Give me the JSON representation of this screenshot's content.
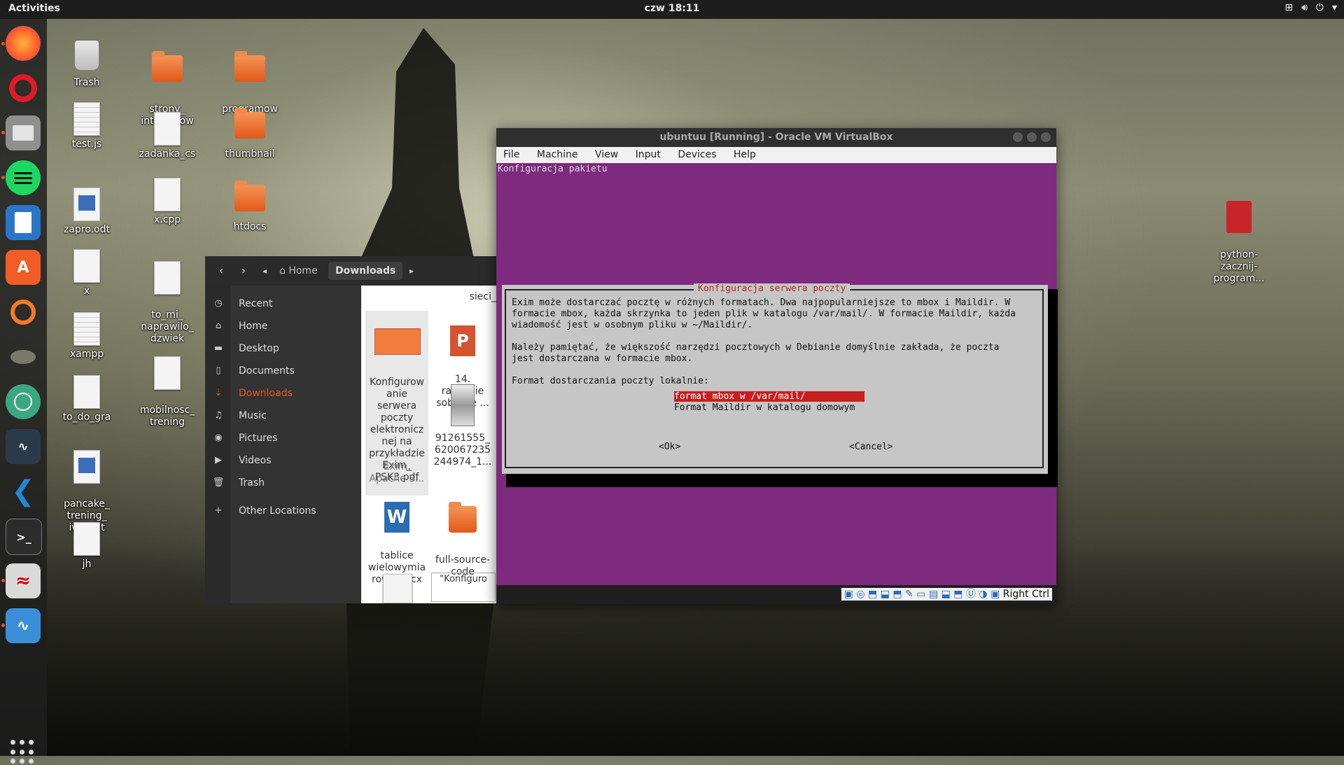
{
  "topbar": {
    "activities": "Activities",
    "clock": "czw 18:11",
    "tray_icons": [
      "network-icon",
      "volume-icon",
      "power-icon",
      "chevron-down-icon"
    ]
  },
  "dock": {
    "items": [
      {
        "name": "firefox",
        "letter": "",
        "color": "#ff7139"
      },
      {
        "name": "opera",
        "letter": "O",
        "color": "#e11a27"
      },
      {
        "name": "files",
        "letter": "",
        "color": "#8a8a8a"
      },
      {
        "name": "spotify",
        "letter": "",
        "color": "#1ed760"
      },
      {
        "name": "writer",
        "letter": "",
        "color": "#2a76c6"
      },
      {
        "name": "software",
        "letter": "A",
        "color": "#f15c27"
      },
      {
        "name": "blender",
        "letter": "",
        "color": "#f5792a"
      },
      {
        "name": "gimp",
        "letter": "",
        "color": "#6e6e6e"
      },
      {
        "name": "atom",
        "letter": "",
        "color": "#3ba781"
      },
      {
        "name": "system-monitor",
        "letter": "",
        "color": "#2b3a4b"
      },
      {
        "name": "vscode",
        "letter": "",
        "color": "#1f8ad2"
      },
      {
        "name": "terminal",
        "letter": ">_",
        "color": "#2c2c2c"
      },
      {
        "name": "pdf-reader",
        "letter": "",
        "color": "#d9d9d9"
      },
      {
        "name": "monitor",
        "letter": "",
        "color": "#3a8fd8"
      }
    ]
  },
  "desktop": {
    "icons": [
      {
        "label": "Trash",
        "type": "trash"
      },
      {
        "label": "strony_\ninternetow\ne",
        "type": "folder"
      },
      {
        "label": "programow\nanie",
        "type": "folder"
      },
      {
        "label": "test.js",
        "type": "doc"
      },
      {
        "label": "zadanka_cs",
        "type": "doc"
      },
      {
        "label": "thumbnail",
        "type": "folder"
      },
      {
        "label": "zapro.odt",
        "type": "odt"
      },
      {
        "label": "x.cpp",
        "type": "doc"
      },
      {
        "label": "htdocs",
        "type": "folder"
      },
      {
        "label": "x",
        "type": "doc"
      },
      {
        "label": "to_mi_\nnaprawilo_\ndzwiek",
        "type": "doc"
      },
      {
        "label": "xampp",
        "type": "doc"
      },
      {
        "label": "mobilnosc_\ntrening",
        "type": "doc"
      },
      {
        "label": "to_do_gra",
        "type": "doc"
      },
      {
        "label": "pancake_\ntrening_\niwo.odt",
        "type": "odt"
      },
      {
        "label": "jh",
        "type": "doc"
      },
      {
        "label": "python-\nzacznij-\nprogram...",
        "type": "pdf"
      }
    ]
  },
  "files": {
    "breadcrumb": {
      "home": "Home",
      "current": "Downloads"
    },
    "sidebar": [
      {
        "label": "Recent",
        "icon": "clock-icon"
      },
      {
        "label": "Home",
        "icon": "home-icon"
      },
      {
        "label": "Desktop",
        "icon": "desktop-icon"
      },
      {
        "label": "Documents",
        "icon": "document-icon"
      },
      {
        "label": "Downloads",
        "icon": "download-icon",
        "selected": true
      },
      {
        "label": "Music",
        "icon": "music-icon"
      },
      {
        "label": "Pictures",
        "icon": "camera-icon"
      },
      {
        "label": "Videos",
        "icon": "video-icon"
      },
      {
        "label": "Trash",
        "icon": "trash-icon"
      },
      {
        "label": "Other Locations",
        "icon": "plus-icon"
      }
    ],
    "content_path": "sieci_",
    "items": [
      {
        "label": "Konfigurow\nanie\nserwera\npoczty\nelektronicz\nnej na\nprzykładzie\nExim_\nPSK3.pdf",
        "type": "pdf-thumb",
        "selected": true
      },
      {
        "label": "14.\nradzenie\nsobie ze ...",
        "type": "ppt"
      },
      {
        "label": "91261555_\n620067235\n244974_1...",
        "type": "image"
      },
      {
        "label": "Exim,\nApache S...",
        "type": "text"
      },
      {
        "label": "tablice\nwielowymia\nrowe.docx",
        "type": "word"
      },
      {
        "label": "full-source-\ncode",
        "type": "folder"
      },
      {
        "label": "\"Konfiguro",
        "type": "doc"
      }
    ]
  },
  "vbox": {
    "title": "ubuntuu [Running] - Oracle VM VirtualBox",
    "menu": [
      "File",
      "Machine",
      "View",
      "Input",
      "Devices",
      "Help"
    ],
    "screen_caption": "Konfiguracja pakietu",
    "dialog": {
      "title": "Konfiguracja serwera poczty",
      "text": "Exim może dostarczać pocztę w różnych formatach. Dwa najpopularniejsze to mbox i Maildir. W\nformacie mbox, każda skrzynka to jeden plik w katalogu /var/mail/. W formacie Maildir, każda\nwiadomość jest w osobnym pliku w ~/Maildir/.\n\nNależy pamiętać, że większość narzędzi pocztowych w Debianie domyślnie zakłada, że poczta\njest dostarczana w formacie mbox.\n\nFormat dostarczania poczty lokalnie:",
      "options": [
        "format mbox w /var/mail/",
        "Format Maildir w katalogu domowym"
      ],
      "selected_option": 0,
      "ok": "<Ok>",
      "cancel": "<Cancel>"
    },
    "hostkey": "Right Ctrl"
  }
}
